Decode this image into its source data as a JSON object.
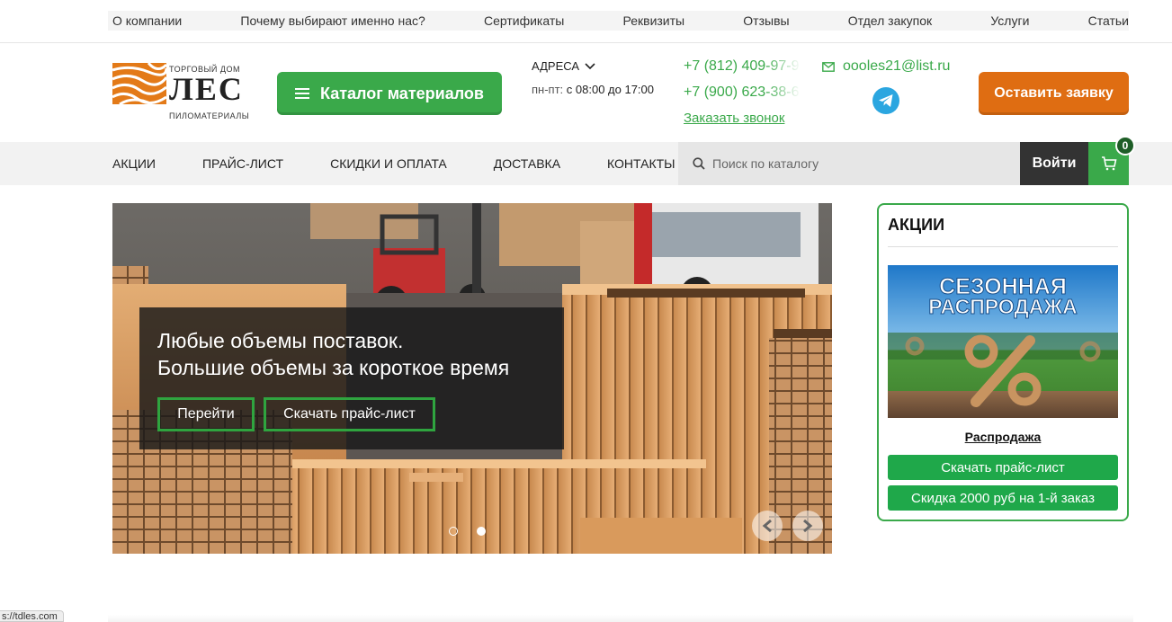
{
  "topnav": {
    "items": [
      "О компании",
      "Почему выбирают именно нас?",
      "Сертификаты",
      "Реквизиты",
      "Отзывы",
      "Отдел закупок",
      "Услуги",
      "Статьи"
    ]
  },
  "logo": {
    "top": "ТОРГОВЫЙ ДОМ",
    "main": "ЛЕС",
    "sub": "ПИЛОМАТЕРИАЛЫ"
  },
  "header": {
    "catalog_label": "Каталог материалов",
    "address_label": "АДРЕСА",
    "hours_label": "пн-пт:",
    "hours_value": "с 08:00 до 17:00",
    "phone1": "+7 (812) 409-97-9",
    "phone2": "+7 (900) 623-38-6",
    "callback": "Заказать звонок",
    "email": "oooles21@list.ru",
    "order_label": "Оставить заявку"
  },
  "mainnav": {
    "items": [
      "АКЦИИ",
      "ПРАЙС-ЛИСТ",
      "СКИДКИ И ОПЛАТА",
      "ДОСТАВКА",
      "КОНТАКТЫ"
    ],
    "search_placeholder": "Поиск по каталогу",
    "login_label": "Войти",
    "cart_count": "0"
  },
  "hero": {
    "title_line1": "Любые объемы поставок.",
    "title_line2": "Большие объемы за короткое время",
    "btn_go": "Перейти",
    "btn_price": "Скачать прайс-лист",
    "active_slide": 2,
    "slides": 2
  },
  "promo": {
    "title": "АКЦИИ",
    "banner_line1": "СЕЗОННАЯ",
    "banner_line2": "РАСПРОДАЖА",
    "caption": "Распродажа",
    "btn_price": "Скачать прайс-лист",
    "btn_discount": "Скидка 2000 руб на 1-й заказ"
  },
  "statusbar": {
    "url": "s://tdles.com"
  },
  "colors": {
    "green": "#3aa94a",
    "orange": "#df6d12",
    "dark": "#333333",
    "telegram": "#2ba6e0"
  }
}
